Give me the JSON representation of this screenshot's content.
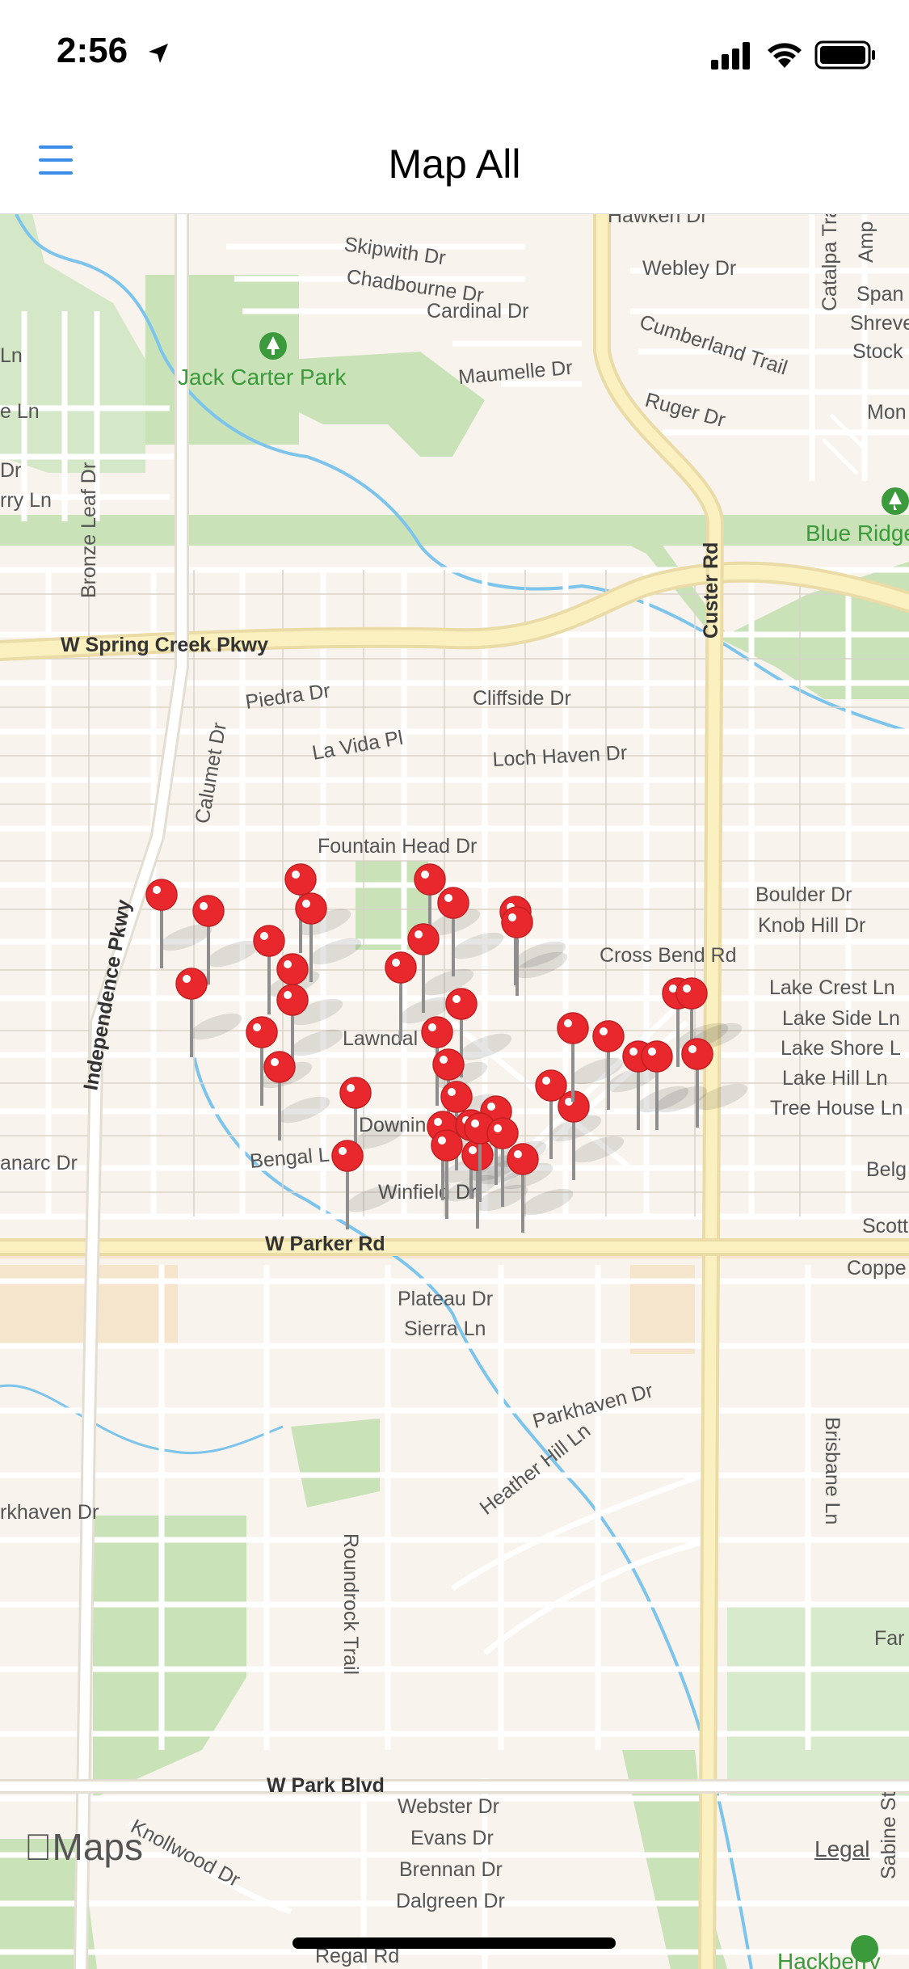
{
  "status_bar": {
    "time": "2:56",
    "icons": [
      "location-arrow-icon",
      "cellular-signal-icon",
      "wifi-icon",
      "battery-icon"
    ]
  },
  "nav": {
    "title": "Map All",
    "menu_icon": "hamburger-menu-icon",
    "accent": "#3b8ee8"
  },
  "map": {
    "parks": [
      "Jack Carter Park",
      "Blue Ridge"
    ],
    "streets": [
      "Hawken Dr",
      "Skipwith Dr",
      "Chadbourne Dr",
      "Cardinal Dr",
      "Webley Dr",
      "Cumberland Trail",
      "Maumelle Dr",
      "Ruger Dr",
      "Catalpa Trail",
      "Span",
      "Shreve",
      "Stock",
      "Mon",
      "Bronze Leaf Dr",
      "Custer Rd",
      "W Spring Creek Pkwy",
      "Piedra Dr",
      "Cliffside Dr",
      "La Vida Pl",
      "Loch Haven Dr",
      "Calumet Dr",
      "Fountain Head Dr",
      "Boulder Dr",
      "Knob Hill Dr",
      "Cross Bend Rd",
      "Lake Crest Ln",
      "Lake Side Ln",
      "Lake Shore L",
      "Lake Hill Ln",
      "Tree House Ln",
      "Independence Pkwy",
      "Lawndal",
      "Downin",
      "Bengal L",
      "Winfield Dr",
      "anarc Dr",
      "Belg",
      "Scott",
      "W Parker Rd",
      "Coppe",
      "Plateau Dr",
      "Sierra Ln",
      "Parkhaven Dr",
      "Heather Hill Ln",
      "Brisbane Ln",
      "rkhaven Dr",
      "Roundrock Trail",
      "Far",
      "W Park Blvd",
      "Knollwood Dr",
      "Webster Dr",
      "Evans Dr",
      "Brennan Dr",
      "Dalgreen Dr",
      "Regal Rd",
      "Sabine St",
      "Ln",
      "e Ln",
      "Dr",
      "rry Ln",
      "Amp",
      "Hackberry"
    ],
    "pin_color": "#e8282c",
    "pin_count": 42,
    "attribution": "Maps",
    "legal": "Legal"
  }
}
